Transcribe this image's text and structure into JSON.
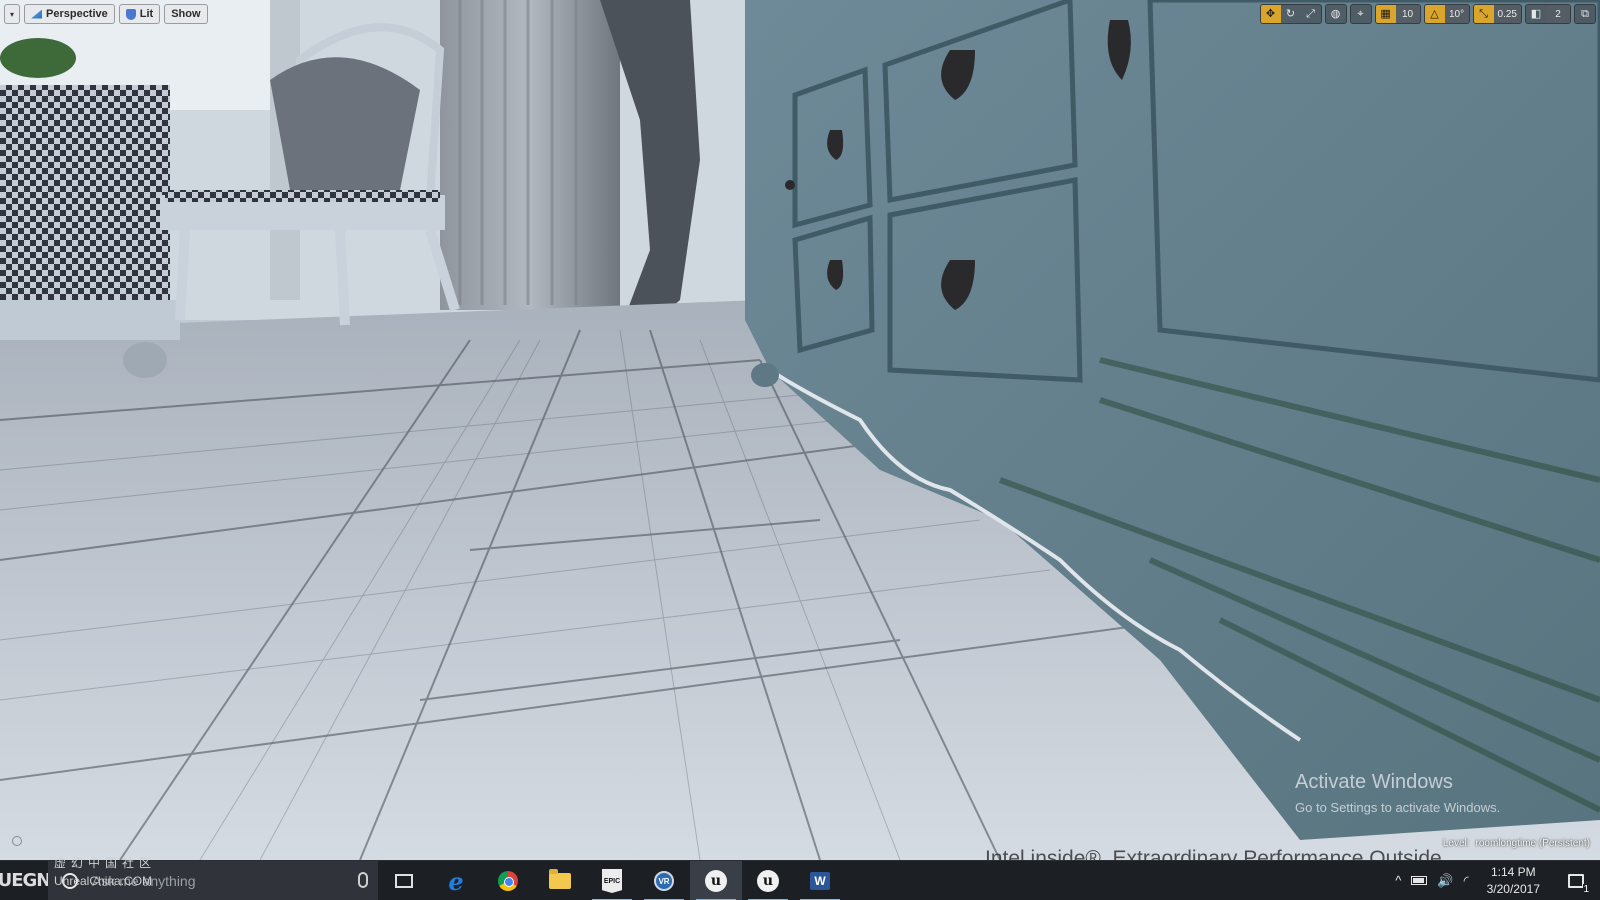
{
  "viewport": {
    "menu_chevron": "▾",
    "view_mode_label": "Perspective",
    "lighting_label": "Lit",
    "show_label": "Show",
    "grid_snap_value": "10",
    "rotation_snap_value": "10°",
    "scale_snap_value": "0.25",
    "camera_speed_value": "2",
    "level_caption": "Level:",
    "level_name": "roomlongtime (Persistent)"
  },
  "watermark": {
    "title": "Activate Windows",
    "subtitle": "Go to Settings to activate Windows.",
    "background_text": "Intel inside®. Extraordinary Performance Outside."
  },
  "taskbar": {
    "logo_text": "UEGN",
    "search_placeholder": "Ask me anything",
    "brand_cn": "虚幻中国社区",
    "brand_en": "UnrealChina.COM",
    "apps": [
      {
        "name": "edge",
        "label": "e"
      },
      {
        "name": "chrome",
        "label": ""
      },
      {
        "name": "file-explorer",
        "label": ""
      },
      {
        "name": "epic-games-launcher",
        "label": "EPIC"
      },
      {
        "name": "vr-app",
        "label": "VR"
      },
      {
        "name": "unreal-editor-1",
        "label": "u"
      },
      {
        "name": "unreal-editor-2",
        "label": "u"
      },
      {
        "name": "word",
        "label": "W"
      }
    ],
    "tray": {
      "chevron": "^",
      "volume": "🔊"
    },
    "time": "1:14 PM",
    "date": "3/20/2017",
    "notification_count": "1"
  },
  "colors": {
    "taskbar_bg": "#1c1f24",
    "snap_active": "#d9a52a",
    "running_indicator": "#76b9ed"
  }
}
